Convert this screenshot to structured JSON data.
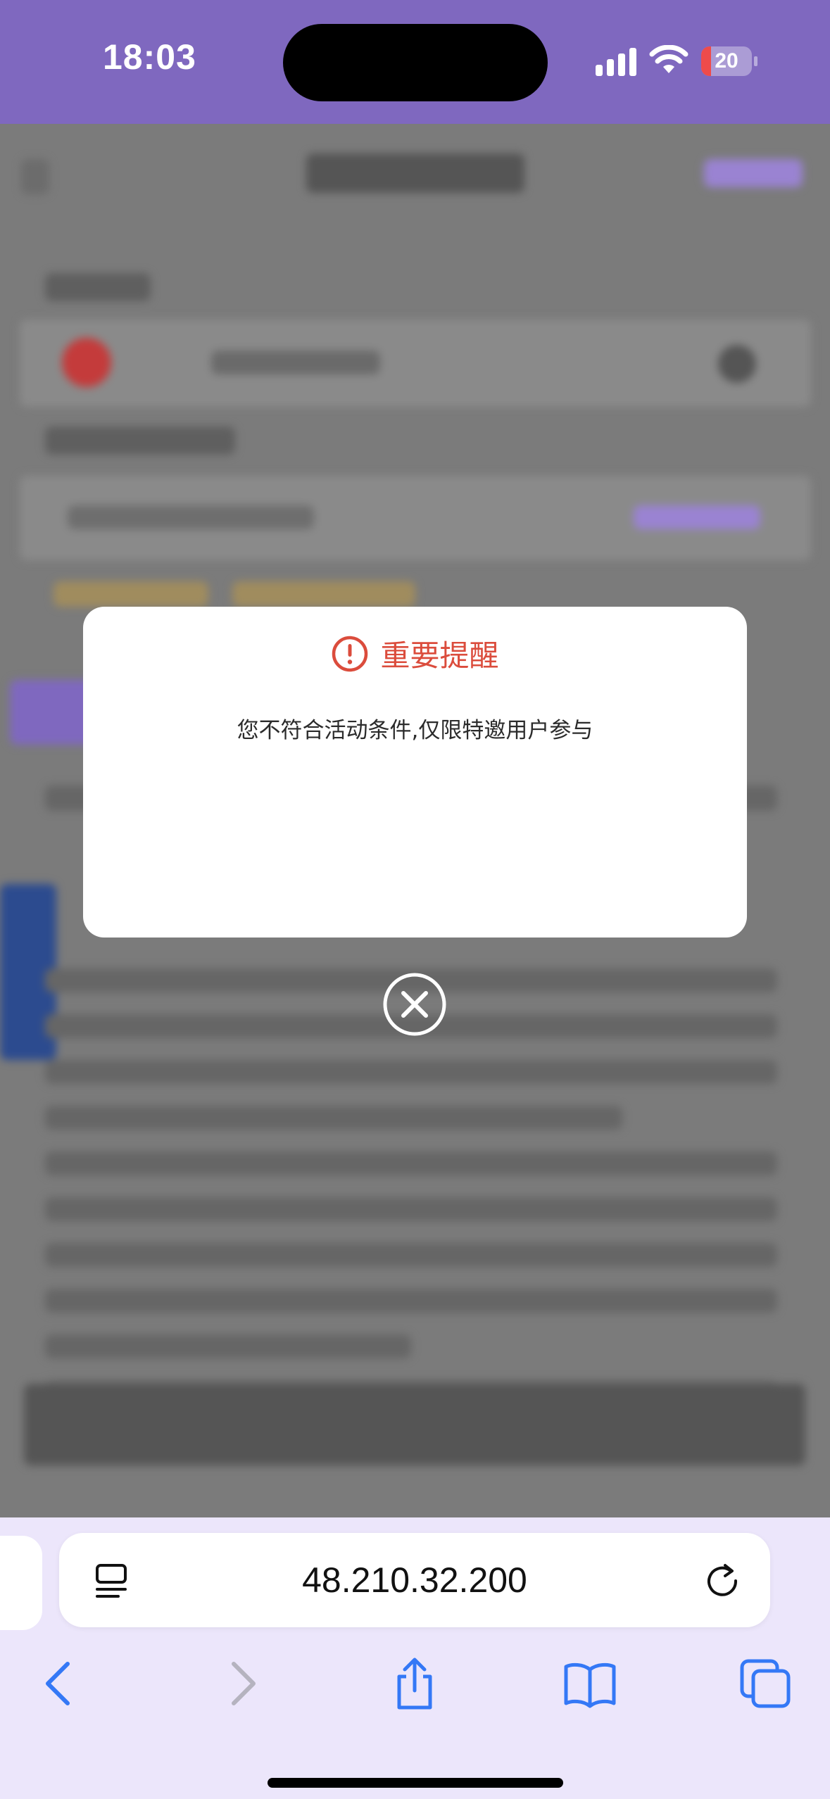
{
  "status_bar": {
    "time": "18:03",
    "battery_level": "20",
    "battery_fraction": 0.2,
    "signal_icon": "signal-icon",
    "wifi_icon": "wifi-icon"
  },
  "dialog": {
    "title": "重要提醒",
    "message": "您不符合活动条件,仅限特邀用户参与",
    "title_color": "#db4c3c",
    "icon": "alert-circle-icon"
  },
  "close_button": {
    "icon": "close-circle-icon"
  },
  "browser": {
    "url": "48.210.32.200",
    "reader_icon": "reader-icon",
    "reload_icon": "reload-icon",
    "nav": {
      "back_icon": "chevron-left-icon",
      "forward_icon": "chevron-right-icon",
      "share_icon": "share-icon",
      "bookmarks_icon": "book-icon",
      "tabs_icon": "tabs-icon"
    },
    "accent": "#3478f6"
  },
  "colors": {
    "status_bar": "#7f68bf",
    "overlay": "#7b7b7b",
    "browser_bar": "#ece6fb"
  }
}
